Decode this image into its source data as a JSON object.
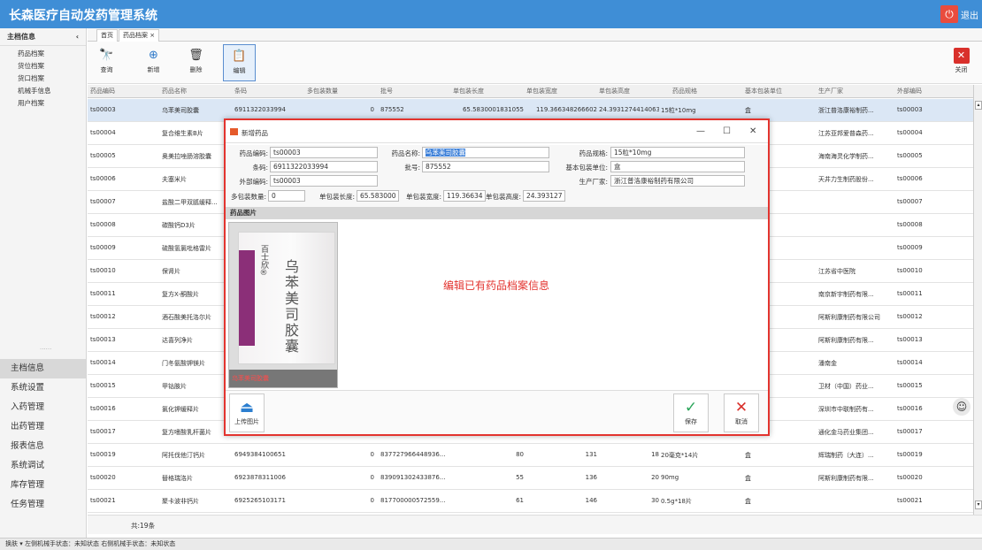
{
  "app": {
    "title": "长森医疗自动发药管理系统",
    "exit_label": "退出"
  },
  "sidebar": {
    "header": "主档信息",
    "collapse": "‹",
    "items": [
      "药品档案",
      "货位档案",
      "货口档案",
      "机械手信息",
      "用户档案"
    ],
    "grid_dots": "......",
    "modules": [
      "主档信息",
      "系统设置",
      "入药管理",
      "出药管理",
      "报表信息",
      "系统调试",
      "库存管理",
      "任务管理"
    ]
  },
  "tabs": [
    {
      "label": "首页"
    },
    {
      "label": "药品档案 ×"
    }
  ],
  "toolbar": {
    "query": "查询",
    "add": "新增",
    "delete": "删除",
    "edit": "编辑",
    "close": "关闭"
  },
  "table": {
    "headers": [
      "药品编码",
      "药品名称",
      "条码",
      "多包装数量",
      "批号",
      "单包装长度",
      "单包装宽度",
      "单包装高度",
      "药品规格",
      "基本包装单位",
      "生产厂家",
      "外部编码"
    ],
    "rows": [
      [
        "ts00003",
        "乌苯美司胶囊",
        "6911322033994",
        "0",
        "875552",
        "65.5830001831055",
        "119.366348266602",
        "24.3931274414063",
        "15粒*10mg",
        "盒",
        "浙江普洛康裕制药...",
        "ts00003"
      ],
      [
        "ts00004",
        "复合维生素B片",
        "",
        "",
        "",
        "",
        "",
        "",
        "",
        "",
        "江苏亚邦爱普森药...",
        "ts00004"
      ],
      [
        "ts00005",
        "奥美拉唑肠溶胶囊",
        "",
        "",
        "",
        "",
        "",
        "",
        "",
        "",
        "海南海灵化学制药...",
        "ts00005"
      ],
      [
        "ts00006",
        "夫塞米片",
        "",
        "",
        "",
        "",
        "",
        "",
        "",
        "",
        "天井力生制药股份...",
        "ts00006"
      ],
      [
        "ts00007",
        "盐酸二甲双胍缓释...",
        "",
        "",
        "",
        "",
        "",
        "",
        "",
        "",
        "",
        "ts00007"
      ],
      [
        "ts00008",
        "碳酸钙D3片",
        "",
        "",
        "",
        "",
        "",
        "",
        "",
        "",
        "",
        "ts00008"
      ],
      [
        "ts00009",
        "硫酸氢氯吡格雷片",
        "",
        "",
        "",
        "",
        "",
        "",
        "",
        "",
        "",
        "ts00009"
      ],
      [
        "ts00010",
        "保肾片",
        "",
        "",
        "",
        "",
        "",
        "",
        "",
        "",
        "江苏省中医院",
        "ts00010"
      ],
      [
        "ts00011",
        "复方X-酮酸片",
        "",
        "",
        "",
        "",
        "",
        "",
        "",
        "",
        "南京新宇制药有限...",
        "ts00011"
      ],
      [
        "ts00012",
        "酒石酸美托洛尔片",
        "",
        "",
        "",
        "",
        "",
        "",
        "",
        "",
        "阿斯利康制药有限公司",
        "ts00012"
      ],
      [
        "ts00013",
        "达喜列净片",
        "",
        "",
        "",
        "",
        "",
        "",
        "",
        "",
        "阿斯利康制药有限...",
        "ts00013"
      ],
      [
        "ts00014",
        "门冬氨酸钾镁片",
        "",
        "",
        "",
        "",
        "",
        "",
        "",
        "",
        "潘南金",
        "ts00014"
      ],
      [
        "ts00015",
        "甲钴胺片",
        "",
        "",
        "",
        "",
        "",
        "",
        "",
        "",
        "卫材（中国）药业...",
        "ts00015"
      ],
      [
        "ts00016",
        "氯化钾缓释片",
        "",
        "",
        "",
        "",
        "",
        "",
        "",
        "",
        "深圳市中联制药有...",
        "ts00016"
      ],
      [
        "ts00017",
        "复方嗜酸乳杆菌片",
        "6926414000914",
        "0",
        "112233212",
        "64.6660003662109",
        "136.929626464844",
        "30.4297180175781",
        "0.5克",
        "盒",
        "通化金马药业集团...",
        "ts00017"
      ],
      [
        "ts00019",
        "阿托伐他汀钙片",
        "6949384100651",
        "0",
        "837727966448936...",
        "80",
        "131",
        "18",
        "20毫克*14片",
        "盒",
        "辉瑞制药（大连）...",
        "ts00019"
      ],
      [
        "ts00020",
        "替格瑞洛片",
        "6923878311006",
        "0",
        "839091302433876...",
        "55",
        "136",
        "20",
        "90mg",
        "盒",
        "阿斯利康制药有限...",
        "ts00020"
      ],
      [
        "ts00021",
        "聚卡波非钙片",
        "6925265103171",
        "0",
        "817700000572559...",
        "61",
        "146",
        "30",
        "0.5g*18片",
        "盒",
        "",
        "ts00021"
      ]
    ]
  },
  "footer": {
    "count": "共:19条"
  },
  "statusbar": "换肤 ▾  左侧机械手状态：未知状态   右侧机械手状态：未知状态",
  "dialog": {
    "title": "新增药品",
    "window_buttons": [
      "—",
      "☐",
      "✕"
    ],
    "labels": {
      "code": "药品编码:",
      "name": "药品名称:",
      "spec": "药品规格:",
      "barcode": "条码:",
      "batch": "批号:",
      "unit": "基本包装单位:",
      "ext_code": "外部编码:",
      "maker": "生产厂家:",
      "multi_qty": "多包装数量:",
      "len": "单包装长度:",
      "wid": "单包装宽度:",
      "hei": "单包装高度:"
    },
    "values": {
      "code": "ts00003",
      "name": "乌苯美司胶囊",
      "spec": "15粒*10mg",
      "barcode": "6911322033994",
      "batch": "875552",
      "unit": "盒",
      "ext_code": "ts00003",
      "maker": "浙江普洛康裕制药有限公司",
      "multi_qty": "0",
      "len": "65.583000",
      "wid": "119.36634",
      "hei": "24.393127"
    },
    "image_section": "药品图片",
    "image_caption": "乌苯美司胶囊",
    "box_text": "乌苯美司胶囊",
    "box_text_small": "百士欣®",
    "message": "编辑已有药品档案信息",
    "upload": "上传图片",
    "save": "保存",
    "cancel": "取消"
  }
}
